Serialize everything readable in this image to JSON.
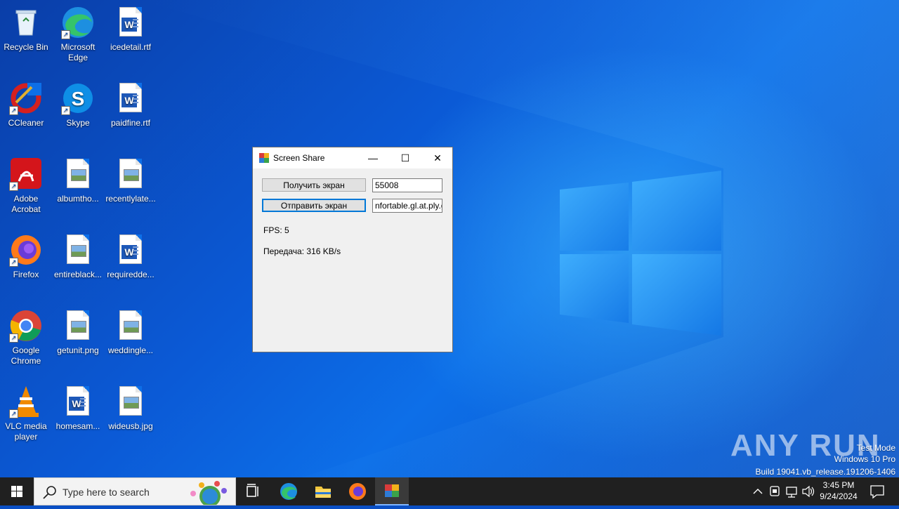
{
  "desktop": {
    "icons": [
      {
        "name": "Recycle Bin"
      },
      {
        "name": "Microsoft Edge"
      },
      {
        "name": "icedetail.rtf"
      },
      {
        "name": "CCleaner"
      },
      {
        "name": "Skype"
      },
      {
        "name": "paidfine.rtf"
      },
      {
        "name": "Adobe Acrobat"
      },
      {
        "name": "albumtho..."
      },
      {
        "name": "recentlylate..."
      },
      {
        "name": "Firefox"
      },
      {
        "name": "entireblack..."
      },
      {
        "name": "requiredde..."
      },
      {
        "name": "Google Chrome"
      },
      {
        "name": "getunit.png"
      },
      {
        "name": "weddingle..."
      },
      {
        "name": "VLC media player"
      },
      {
        "name": "homesam..."
      },
      {
        "name": "wideusb.jpg"
      }
    ]
  },
  "window": {
    "title": "Screen Share",
    "buttons": {
      "get_screen": "Получить экран",
      "send_screen": "Отправить экран"
    },
    "inputs": {
      "port": "55008",
      "host": "nfortable.gl.at.ply.gg"
    },
    "fps": "FPS: 5",
    "transfer": "Передача: 316 KB/s",
    "controls": {
      "minimize": "—",
      "maximize": "☐",
      "close": "✕"
    }
  },
  "watermark": {
    "logo": "ANY RUN",
    "test_mode": "Test Mode",
    "edition": "Windows 10 Pro",
    "build": "Build 19041.vb_release.191206-1406"
  },
  "taskbar": {
    "search_placeholder": "Type here to search",
    "time": "3:45 PM",
    "date": "9/24/2024"
  }
}
